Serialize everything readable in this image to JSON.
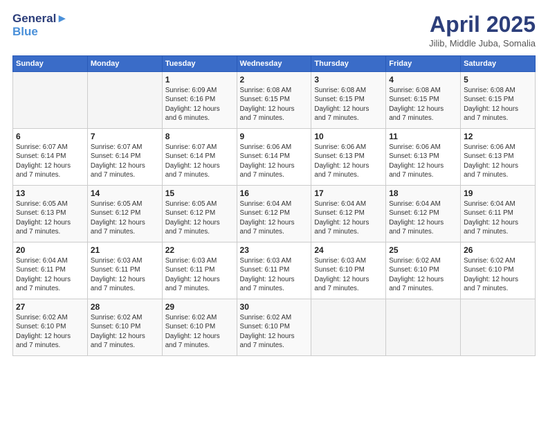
{
  "header": {
    "logo_line1": "General",
    "logo_line2": "Blue",
    "month_title": "April 2025",
    "location": "Jilib, Middle Juba, Somalia"
  },
  "weekdays": [
    "Sunday",
    "Monday",
    "Tuesday",
    "Wednesday",
    "Thursday",
    "Friday",
    "Saturday"
  ],
  "weeks": [
    [
      {
        "day": "",
        "info": ""
      },
      {
        "day": "",
        "info": ""
      },
      {
        "day": "1",
        "info": "Sunrise: 6:09 AM\nSunset: 6:16 PM\nDaylight: 12 hours\nand 6 minutes."
      },
      {
        "day": "2",
        "info": "Sunrise: 6:08 AM\nSunset: 6:15 PM\nDaylight: 12 hours\nand 7 minutes."
      },
      {
        "day": "3",
        "info": "Sunrise: 6:08 AM\nSunset: 6:15 PM\nDaylight: 12 hours\nand 7 minutes."
      },
      {
        "day": "4",
        "info": "Sunrise: 6:08 AM\nSunset: 6:15 PM\nDaylight: 12 hours\nand 7 minutes."
      },
      {
        "day": "5",
        "info": "Sunrise: 6:08 AM\nSunset: 6:15 PM\nDaylight: 12 hours\nand 7 minutes."
      }
    ],
    [
      {
        "day": "6",
        "info": "Sunrise: 6:07 AM\nSunset: 6:14 PM\nDaylight: 12 hours\nand 7 minutes."
      },
      {
        "day": "7",
        "info": "Sunrise: 6:07 AM\nSunset: 6:14 PM\nDaylight: 12 hours\nand 7 minutes."
      },
      {
        "day": "8",
        "info": "Sunrise: 6:07 AM\nSunset: 6:14 PM\nDaylight: 12 hours\nand 7 minutes."
      },
      {
        "day": "9",
        "info": "Sunrise: 6:06 AM\nSunset: 6:14 PM\nDaylight: 12 hours\nand 7 minutes."
      },
      {
        "day": "10",
        "info": "Sunrise: 6:06 AM\nSunset: 6:13 PM\nDaylight: 12 hours\nand 7 minutes."
      },
      {
        "day": "11",
        "info": "Sunrise: 6:06 AM\nSunset: 6:13 PM\nDaylight: 12 hours\nand 7 minutes."
      },
      {
        "day": "12",
        "info": "Sunrise: 6:06 AM\nSunset: 6:13 PM\nDaylight: 12 hours\nand 7 minutes."
      }
    ],
    [
      {
        "day": "13",
        "info": "Sunrise: 6:05 AM\nSunset: 6:13 PM\nDaylight: 12 hours\nand 7 minutes."
      },
      {
        "day": "14",
        "info": "Sunrise: 6:05 AM\nSunset: 6:12 PM\nDaylight: 12 hours\nand 7 minutes."
      },
      {
        "day": "15",
        "info": "Sunrise: 6:05 AM\nSunset: 6:12 PM\nDaylight: 12 hours\nand 7 minutes."
      },
      {
        "day": "16",
        "info": "Sunrise: 6:04 AM\nSunset: 6:12 PM\nDaylight: 12 hours\nand 7 minutes."
      },
      {
        "day": "17",
        "info": "Sunrise: 6:04 AM\nSunset: 6:12 PM\nDaylight: 12 hours\nand 7 minutes."
      },
      {
        "day": "18",
        "info": "Sunrise: 6:04 AM\nSunset: 6:12 PM\nDaylight: 12 hours\nand 7 minutes."
      },
      {
        "day": "19",
        "info": "Sunrise: 6:04 AM\nSunset: 6:11 PM\nDaylight: 12 hours\nand 7 minutes."
      }
    ],
    [
      {
        "day": "20",
        "info": "Sunrise: 6:04 AM\nSunset: 6:11 PM\nDaylight: 12 hours\nand 7 minutes."
      },
      {
        "day": "21",
        "info": "Sunrise: 6:03 AM\nSunset: 6:11 PM\nDaylight: 12 hours\nand 7 minutes."
      },
      {
        "day": "22",
        "info": "Sunrise: 6:03 AM\nSunset: 6:11 PM\nDaylight: 12 hours\nand 7 minutes."
      },
      {
        "day": "23",
        "info": "Sunrise: 6:03 AM\nSunset: 6:11 PM\nDaylight: 12 hours\nand 7 minutes."
      },
      {
        "day": "24",
        "info": "Sunrise: 6:03 AM\nSunset: 6:10 PM\nDaylight: 12 hours\nand 7 minutes."
      },
      {
        "day": "25",
        "info": "Sunrise: 6:02 AM\nSunset: 6:10 PM\nDaylight: 12 hours\nand 7 minutes."
      },
      {
        "day": "26",
        "info": "Sunrise: 6:02 AM\nSunset: 6:10 PM\nDaylight: 12 hours\nand 7 minutes."
      }
    ],
    [
      {
        "day": "27",
        "info": "Sunrise: 6:02 AM\nSunset: 6:10 PM\nDaylight: 12 hours\nand 7 minutes."
      },
      {
        "day": "28",
        "info": "Sunrise: 6:02 AM\nSunset: 6:10 PM\nDaylight: 12 hours\nand 7 minutes."
      },
      {
        "day": "29",
        "info": "Sunrise: 6:02 AM\nSunset: 6:10 PM\nDaylight: 12 hours\nand 7 minutes."
      },
      {
        "day": "30",
        "info": "Sunrise: 6:02 AM\nSunset: 6:10 PM\nDaylight: 12 hours\nand 7 minutes."
      },
      {
        "day": "",
        "info": ""
      },
      {
        "day": "",
        "info": ""
      },
      {
        "day": "",
        "info": ""
      }
    ]
  ]
}
